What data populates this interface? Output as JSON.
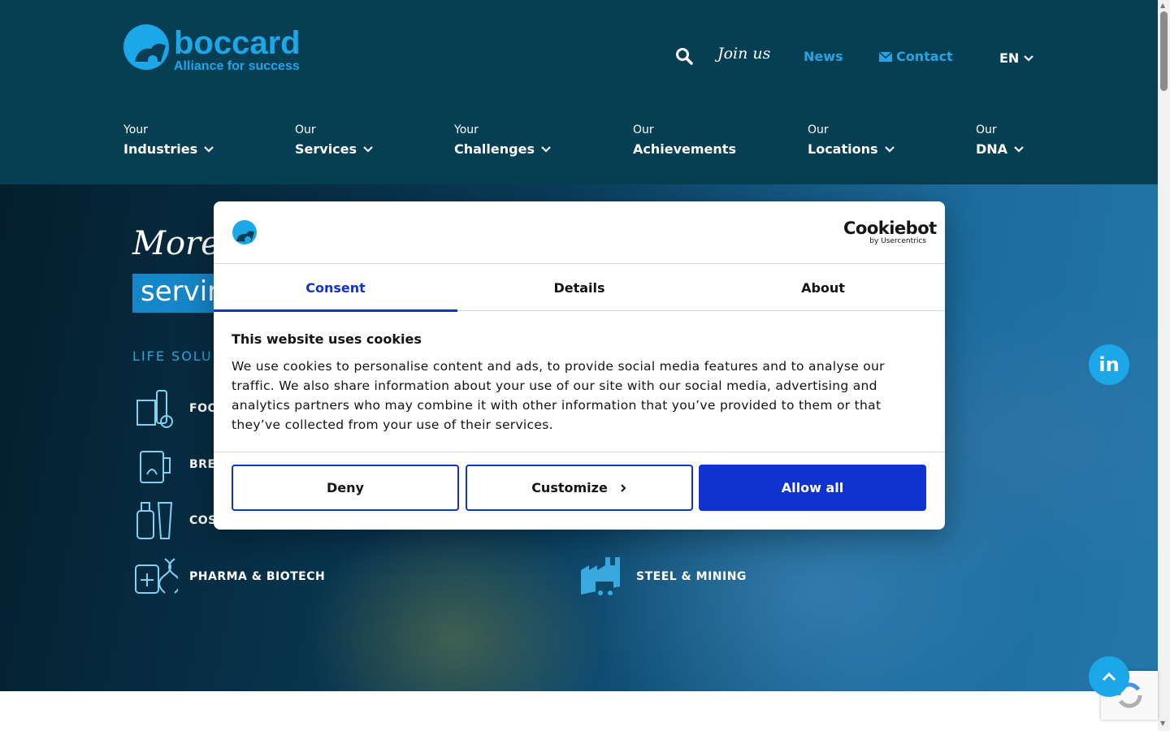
{
  "header": {
    "logo_name": "boccard",
    "logo_tagline": "Alliance for success",
    "join_label": "Join us",
    "news_label": "News",
    "contact_label": "Contact",
    "lang_label": "EN",
    "nav": [
      {
        "small": "Your",
        "big": "Industries"
      },
      {
        "small": "Our",
        "big": "Services"
      },
      {
        "small": "Your",
        "big": "Challenges"
      },
      {
        "small": "Our",
        "big": "Achievements"
      },
      {
        "small": "Our",
        "big": "Locations"
      },
      {
        "small": "Our",
        "big": "DNA"
      }
    ]
  },
  "hero": {
    "title": "More t",
    "subtitle": "servin",
    "section_label": "LIFE SOLU",
    "industries": [
      {
        "label": "FOO",
        "icon": "food-icon"
      },
      {
        "label": "BRE",
        "icon": "brewery-icon"
      },
      {
        "label": "COS",
        "icon": "cosmetics-icon"
      },
      {
        "label": "PHARMA & BIOTECH",
        "icon": "pharma-icon"
      },
      {
        "label": "STEEL & MINING",
        "icon": "steel-mining-icon"
      }
    ]
  },
  "social": {
    "linkedin_label": "in"
  },
  "cookie": {
    "brand": "Cookiebot",
    "brand_sub": "by Usercentrics",
    "tabs": [
      "Consent",
      "Details",
      "About"
    ],
    "title": "This website uses cookies",
    "text": "We use cookies to personalise content and ads, to provide social media features and to analyse our traffic. We also share information about your use of our site with our social media, advertising and analytics partners who may combine it with other information that you’ve provided to them or that they’ve collected from your use of their services.",
    "deny": "Deny",
    "customize": "Customize",
    "allow": "Allow all"
  },
  "colors": {
    "header_bg": "#063e53",
    "accent": "#27a4e0",
    "cookie_primary": "#1032cf"
  }
}
